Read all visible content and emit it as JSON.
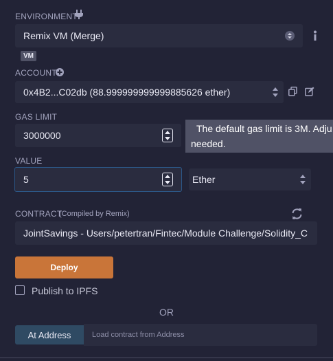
{
  "environment": {
    "label": "ENVIRONMENT",
    "value": "Remix VM (Merge)",
    "badge": "VM"
  },
  "account": {
    "label": "ACCOUNT",
    "value": "0x4B2...C02db (88.999999999999885626 ether)"
  },
  "gas_limit": {
    "label": "GAS LIMIT",
    "value": "3000000",
    "tooltip_line1": "The default gas limit is 3M. Adju",
    "tooltip_line2": "needed."
  },
  "value": {
    "label": "VALUE",
    "amount": "5",
    "unit": "Ether"
  },
  "contract": {
    "label": "CONTRACT",
    "sublabel": "(Compiled by Remix)",
    "value": "JointSavings - Users/petertran/Fintec/Module Challenge/Solidity_C"
  },
  "deploy_label": "Deploy",
  "publish_label": "Publish to IPFS",
  "or_label": "OR",
  "at_address": {
    "button_label": "At Address",
    "placeholder": "Load contract from Address"
  },
  "colors": {
    "background": "#222336",
    "field": "#2a2c3f",
    "deploy": "#c97539",
    "at_address": "#2f4a63",
    "focus": "#25456a"
  },
  "icons": [
    "plug-icon",
    "info-icon",
    "plus-circle-icon",
    "copy-icon",
    "edit-icon",
    "refresh-icon"
  ]
}
